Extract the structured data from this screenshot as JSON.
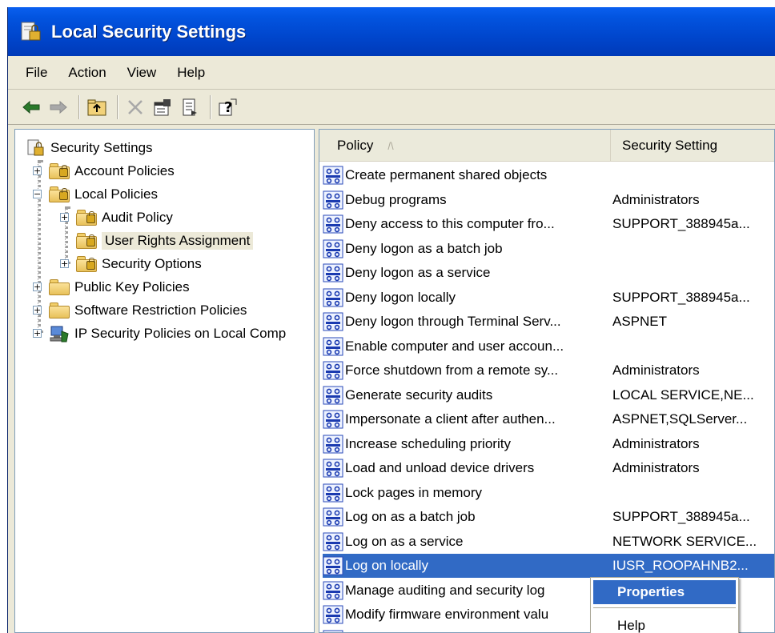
{
  "window": {
    "title": "Local Security Settings"
  },
  "menubar": {
    "items": [
      "File",
      "Action",
      "View",
      "Help"
    ]
  },
  "toolbar": {
    "buttons": [
      "back",
      "forward",
      "up-folder",
      "delete",
      "properties",
      "export-list",
      "help"
    ]
  },
  "tree": {
    "root_label": "Security Settings",
    "items": [
      {
        "label": "Account Policies",
        "expander": "+"
      },
      {
        "label": "Local Policies",
        "expander": "−"
      },
      {
        "label": "Audit Policy",
        "expander": "+"
      },
      {
        "label": "User Rights Assignment",
        "expander": ""
      },
      {
        "label": "Security Options",
        "expander": "+"
      },
      {
        "label": "Public Key Policies",
        "expander": "+"
      },
      {
        "label": "Software Restriction Policies",
        "expander": "+"
      },
      {
        "label": "IP Security Policies on Local Comp",
        "expander": "+"
      }
    ]
  },
  "list": {
    "columns": {
      "policy": "Policy",
      "setting": "Security Setting",
      "sort_indicator": "/\\"
    },
    "rows": [
      {
        "policy": "Create permanent shared objects",
        "setting": ""
      },
      {
        "policy": "Debug programs",
        "setting": "Administrators"
      },
      {
        "policy": "Deny access to this computer fro...",
        "setting": "SUPPORT_388945a..."
      },
      {
        "policy": "Deny logon as a batch job",
        "setting": ""
      },
      {
        "policy": "Deny logon as a service",
        "setting": ""
      },
      {
        "policy": "Deny logon locally",
        "setting": "SUPPORT_388945a..."
      },
      {
        "policy": "Deny logon through Terminal Serv...",
        "setting": "ASPNET"
      },
      {
        "policy": "Enable computer and user accoun...",
        "setting": ""
      },
      {
        "policy": "Force shutdown from a remote sy...",
        "setting": "Administrators"
      },
      {
        "policy": "Generate security audits",
        "setting": "LOCAL SERVICE,NE..."
      },
      {
        "policy": "Impersonate a client after authen...",
        "setting": "ASPNET,SQLServer..."
      },
      {
        "policy": "Increase scheduling priority",
        "setting": "Administrators"
      },
      {
        "policy": "Load and unload device drivers",
        "setting": "Administrators"
      },
      {
        "policy": "Lock pages in memory",
        "setting": ""
      },
      {
        "policy": "Log on as a batch job",
        "setting": "SUPPORT_388945a..."
      },
      {
        "policy": "Log on as a service",
        "setting": "NETWORK SERVICE..."
      },
      {
        "policy": "Log on locally",
        "setting": "IUSR_ROOPAHNB2..."
      },
      {
        "policy": "Manage auditing and security log",
        "setting": ""
      },
      {
        "policy": "Modify firmware environment valu",
        "setting": ""
      },
      {
        "policy": "Perform volume maintenance task",
        "setting": ""
      }
    ],
    "selected_index": 16
  },
  "context_menu": {
    "items": [
      "Properties",
      "Help"
    ]
  },
  "colors": {
    "title_bar": "#0043c8",
    "selection": "#316ac5",
    "chrome": "#ece9d8"
  }
}
